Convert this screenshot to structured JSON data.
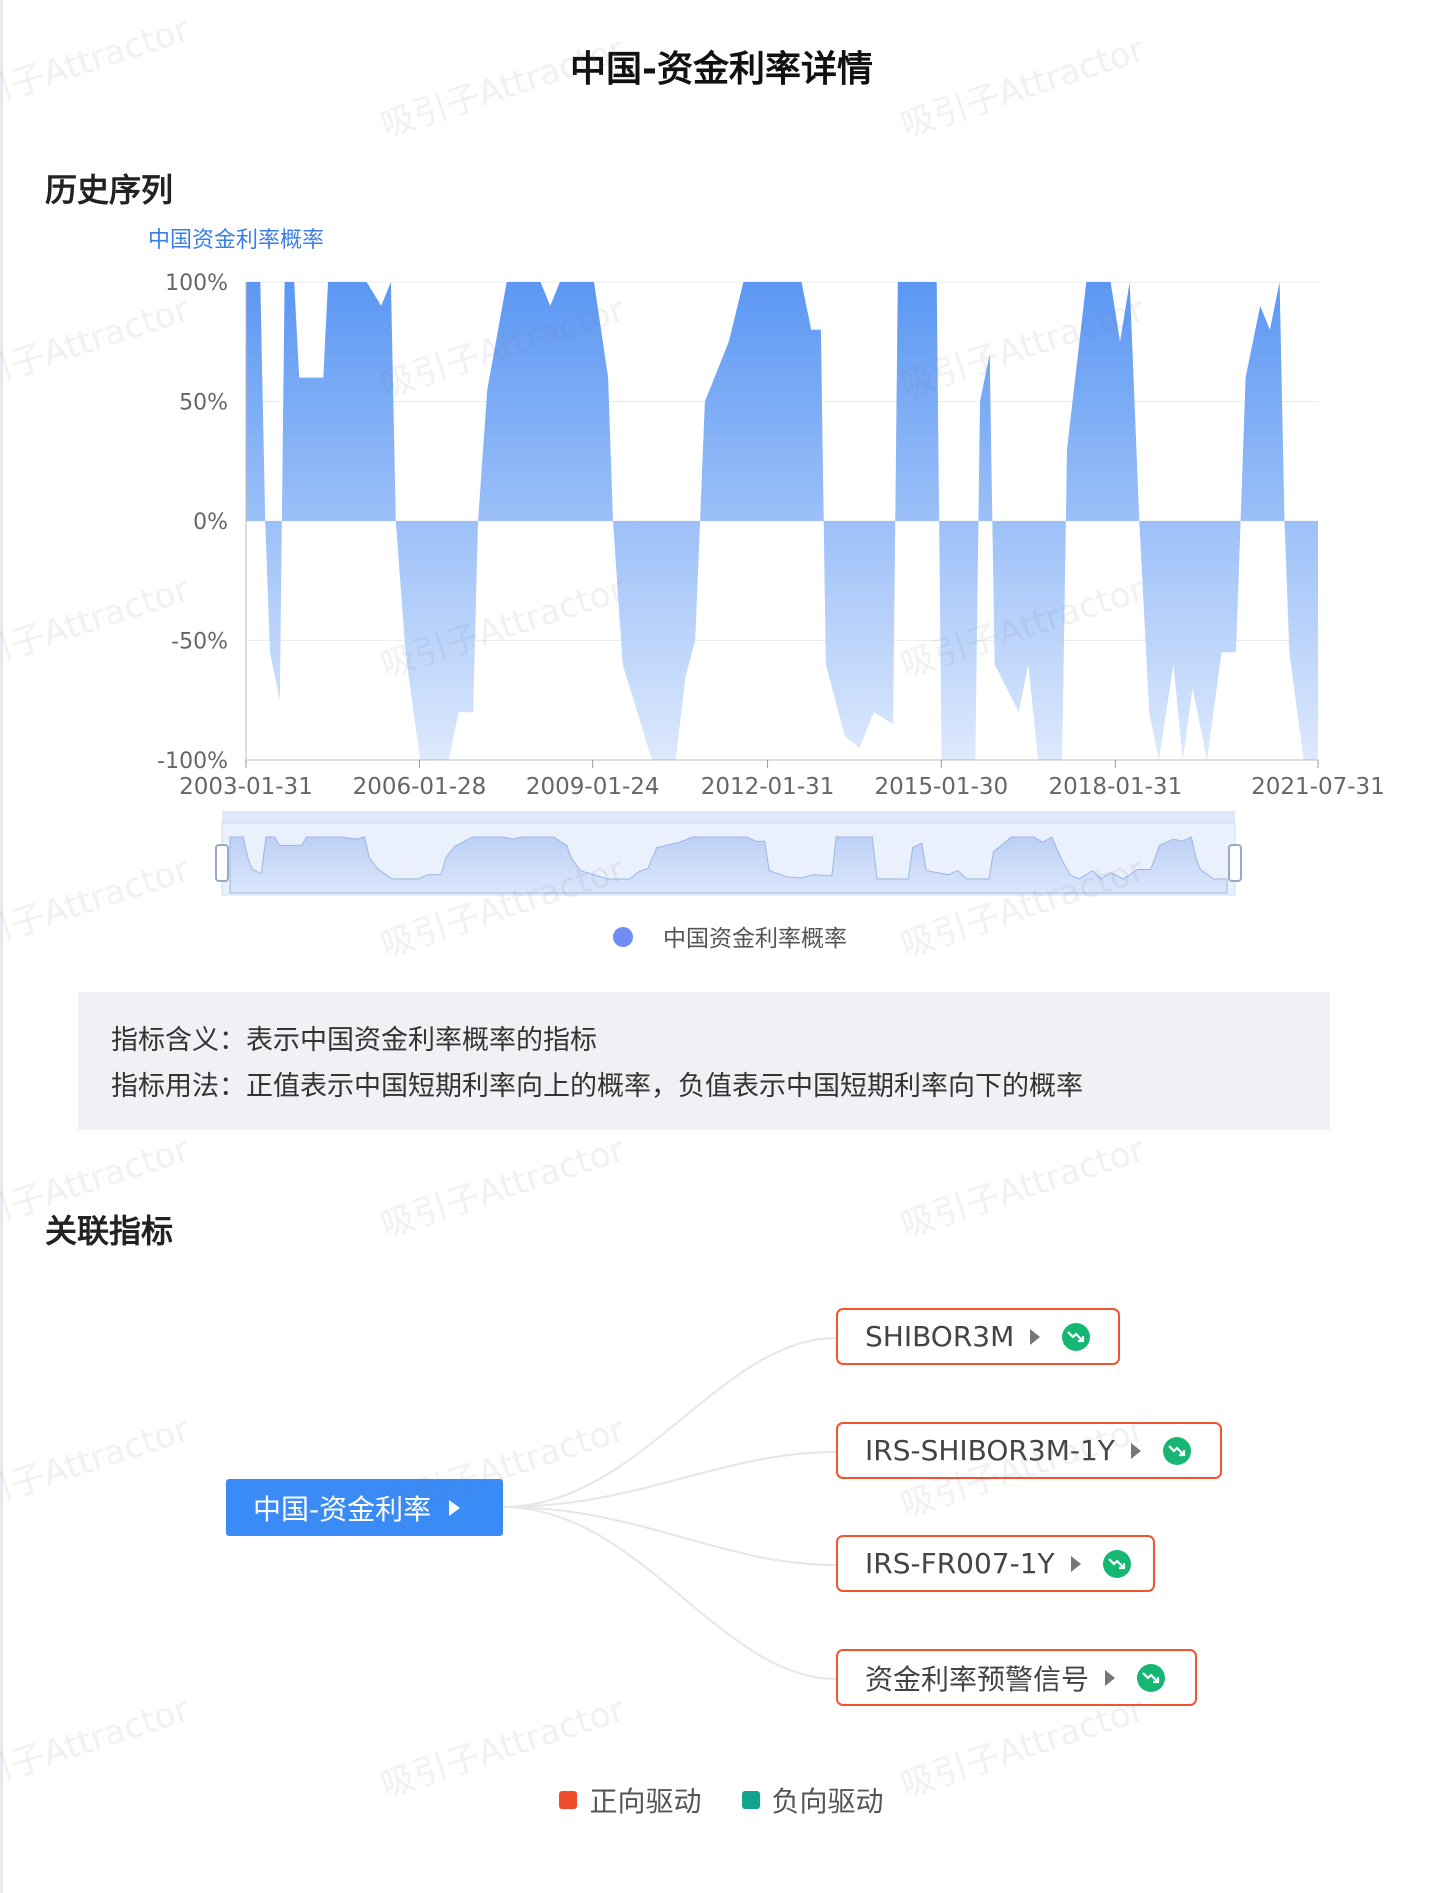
{
  "title": "中国-资金利率详情",
  "history_section": {
    "title": "历史序列"
  },
  "chart_data": {
    "type": "area",
    "title": "",
    "series_name": "中国资金利率概率",
    "ylabel": "中国资金利率概率",
    "y_ticks": [
      "100%",
      "50%",
      "0%",
      "-50%",
      "-100%"
    ],
    "ylim": [
      -100,
      100
    ],
    "x_ticks": [
      "2003-01-31",
      "2006-01-28",
      "2009-01-24",
      "2012-01-31",
      "2015-01-30",
      "2018-01-31",
      "2021-07-31"
    ],
    "x_range": [
      "2003-01-31",
      "2021-07-31"
    ],
    "grid": true,
    "legend": "bottom-center",
    "colors": {
      "fill_top": "#5b97f3",
      "fill_bottom": "#dde9fd",
      "legend_dot": "#6f8ef5"
    },
    "points": [
      [
        "2003-01-31",
        100
      ],
      [
        "2003-05-01",
        100
      ],
      [
        "2003-06-01",
        0
      ],
      [
        "2003-07-01",
        -55
      ],
      [
        "2003-09-01",
        -75
      ],
      [
        "2003-10-01",
        100
      ],
      [
        "2003-12-01",
        100
      ],
      [
        "2004-01-01",
        60
      ],
      [
        "2004-06-01",
        60
      ],
      [
        "2004-07-01",
        100
      ],
      [
        "2005-03-01",
        100
      ],
      [
        "2005-06-01",
        90
      ],
      [
        "2005-08-01",
        100
      ],
      [
        "2005-09-01",
        0
      ],
      [
        "2005-11-01",
        -55
      ],
      [
        "2006-02-01",
        -100
      ],
      [
        "2006-08-01",
        -100
      ],
      [
        "2006-10-01",
        -80
      ],
      [
        "2007-01-01",
        -80
      ],
      [
        "2007-02-01",
        0
      ],
      [
        "2007-04-01",
        55
      ],
      [
        "2007-08-01",
        100
      ],
      [
        "2008-03-01",
        100
      ],
      [
        "2008-05-01",
        90
      ],
      [
        "2008-07-01",
        100
      ],
      [
        "2009-02-01",
        100
      ],
      [
        "2009-05-01",
        60
      ],
      [
        "2009-06-01",
        0
      ],
      [
        "2009-08-01",
        -60
      ],
      [
        "2010-02-01",
        -100
      ],
      [
        "2010-07-01",
        -100
      ],
      [
        "2010-09-01",
        -65
      ],
      [
        "2010-11-01",
        -50
      ],
      [
        "2011-01-01",
        50
      ],
      [
        "2011-06-01",
        75
      ],
      [
        "2011-09-01",
        100
      ],
      [
        "2012-04-01",
        100
      ],
      [
        "2012-09-01",
        100
      ],
      [
        "2012-11-01",
        80
      ],
      [
        "2013-01-01",
        80
      ],
      [
        "2013-02-01",
        -60
      ],
      [
        "2013-06-01",
        -90
      ],
      [
        "2013-09-01",
        -95
      ],
      [
        "2013-12-01",
        -80
      ],
      [
        "2014-04-01",
        -85
      ],
      [
        "2014-05-01",
        100
      ],
      [
        "2015-01-01",
        100
      ],
      [
        "2015-02-01",
        -100
      ],
      [
        "2015-09-01",
        -100
      ],
      [
        "2015-10-01",
        50
      ],
      [
        "2015-12-01",
        70
      ],
      [
        "2016-01-01",
        -60
      ],
      [
        "2016-06-01",
        -80
      ],
      [
        "2016-08-01",
        -60
      ],
      [
        "2016-10-01",
        -100
      ],
      [
        "2017-03-01",
        -100
      ],
      [
        "2017-04-01",
        30
      ],
      [
        "2017-08-01",
        100
      ],
      [
        "2018-01-01",
        100
      ],
      [
        "2018-03-01",
        75
      ],
      [
        "2018-05-01",
        100
      ],
      [
        "2018-07-01",
        0
      ],
      [
        "2018-09-01",
        -80
      ],
      [
        "2018-11-01",
        -100
      ],
      [
        "2019-02-01",
        -60
      ],
      [
        "2019-04-01",
        -100
      ],
      [
        "2019-06-01",
        -70
      ],
      [
        "2019-09-01",
        -100
      ],
      [
        "2019-12-01",
        -55
      ],
      [
        "2020-03-01",
        -55
      ],
      [
        "2020-05-01",
        60
      ],
      [
        "2020-08-01",
        90
      ],
      [
        "2020-10-01",
        80
      ],
      [
        "2020-12-01",
        100
      ],
      [
        "2021-01-01",
        0
      ],
      [
        "2021-02-01",
        -55
      ],
      [
        "2021-05-01",
        -100
      ],
      [
        "2021-07-31",
        -100
      ]
    ]
  },
  "info": {
    "meaning": "指标含义：表示中国资金利率概率的指标",
    "usage": "指标用法：正值表示中国短期利率向上的概率，负值表示中国短期利率向下的概率"
  },
  "related_section": {
    "title": "关联指标"
  },
  "graph": {
    "root": {
      "label": "中国-资金利率"
    },
    "children": [
      {
        "label": "SHIBOR3M",
        "trend": "down-trend-icon"
      },
      {
        "label": "IRS-SHIBOR3M-1Y",
        "trend": "down-trend-icon"
      },
      {
        "label": "IRS-FR007-1Y",
        "trend": "down-trend-icon"
      },
      {
        "label": "资金利率预警信号",
        "trend": "down-trend-icon"
      }
    ],
    "legend": [
      {
        "label": "正向驱动",
        "color": "#f04c2b"
      },
      {
        "label": "负向驱动",
        "color": "#13a391"
      }
    ]
  },
  "watermark_text": "吸引子Attractor"
}
